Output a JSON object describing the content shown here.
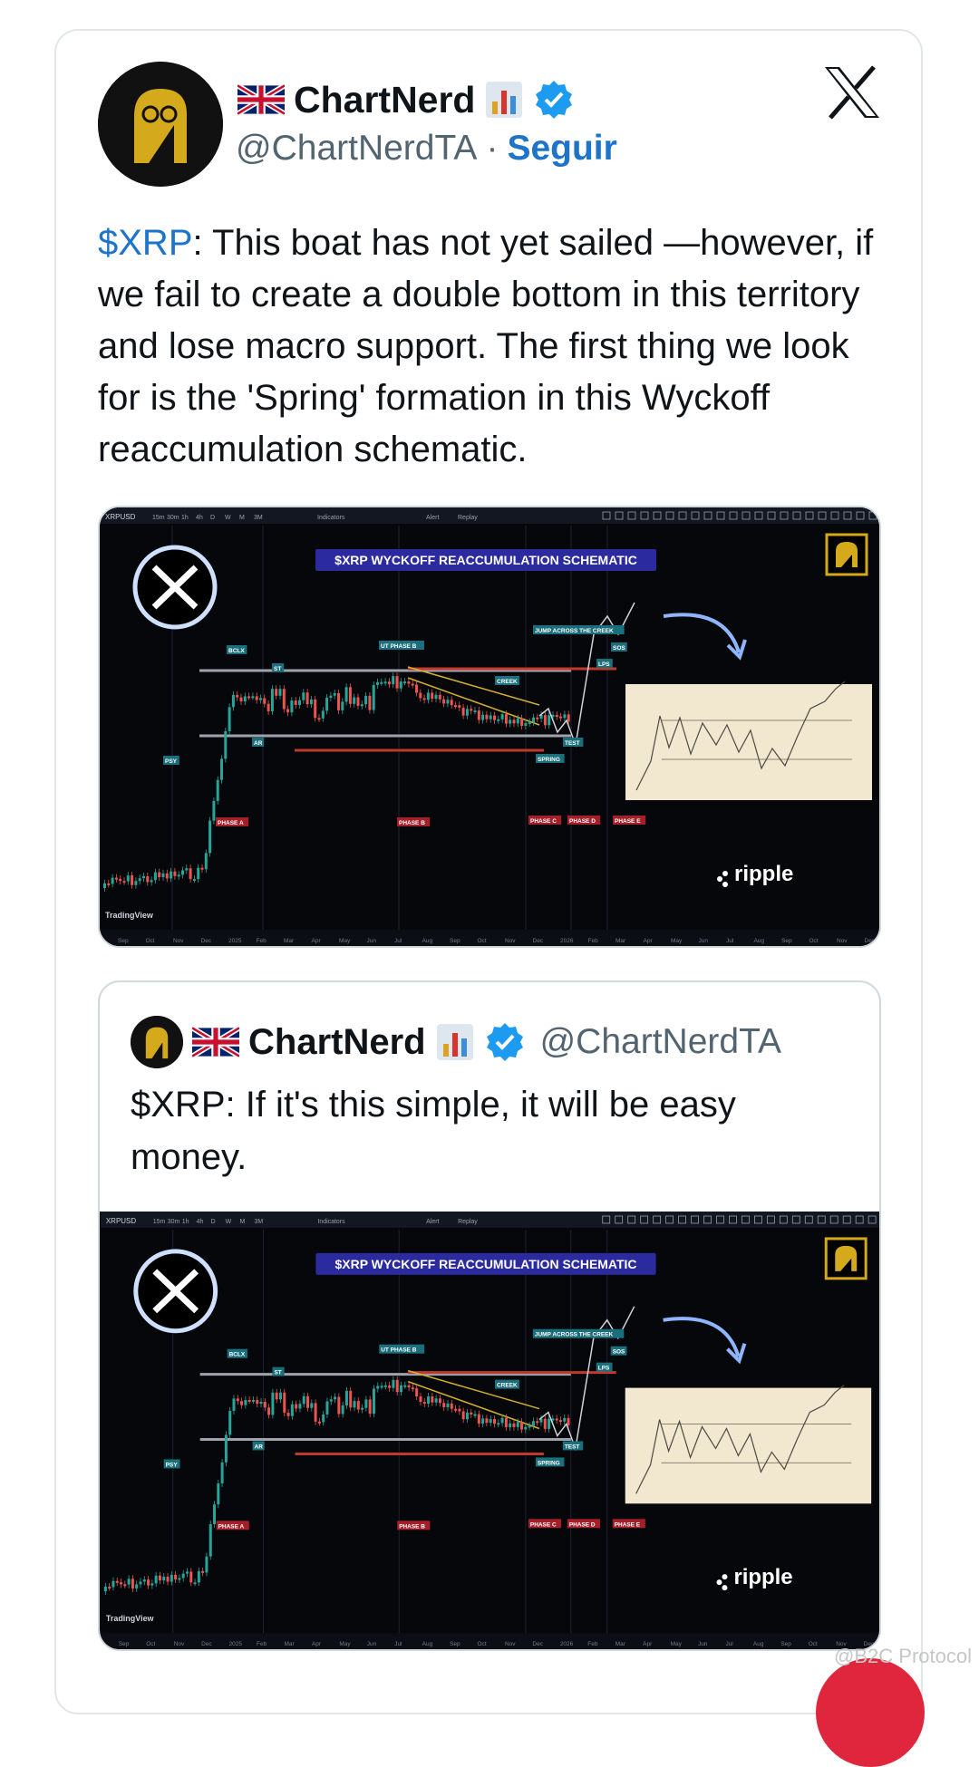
{
  "tweet": {
    "author_name": "ChartNerd",
    "author_handle": "@ChartNerdTA",
    "separator": "·",
    "follow_label": "Seguir",
    "cashtag": "$XRP",
    "text_rest": ": This boat has not yet sailed —however, if we fail to create a double bottom in this territory and lose macro support. The first thing we look for is the 'Spring' formation in this Wyckoff reaccumulation schematic."
  },
  "quote": {
    "author_name": "ChartNerd",
    "author_handle": "@ChartNerdTA",
    "text": "$XRP: If it's this simple, it will be easy money."
  },
  "chart": {
    "symbol": "XRPUSD",
    "timeframes": [
      "15m",
      "30m",
      "1h",
      "4h",
      "D",
      "W",
      "M",
      "3M"
    ],
    "toolbar_indicators": "Indicators",
    "toolbar_alert": "Alert",
    "toolbar_replay": "Replay",
    "title": "$XRP WYCKOFF REACCUMULATION SCHEMATIC",
    "labels": {
      "bclx": "BCLX",
      "st": "ST",
      "ar": "AR",
      "psy": "PSY",
      "ut_phase": "UT PHASE B",
      "creek": "CREEK",
      "jump": "JUMP ACROSS THE CREEK",
      "sos": "SOS",
      "lps": "LPS",
      "test": "TEST",
      "spring": "SPRING",
      "phase_a": "PHASE A",
      "phase_b": "PHASE B",
      "phase_c": "PHASE C",
      "phase_d": "PHASE D",
      "phase_e": "PHASE E"
    },
    "brand": "ripple",
    "tradingview": "TradingView",
    "x_axis": [
      "Sep",
      "Oct",
      "Nov",
      "Dec",
      "2025",
      "Feb",
      "Mar",
      "Apr",
      "May",
      "Jun",
      "Jul",
      "Aug",
      "Sep",
      "Oct",
      "Nov",
      "Dec",
      "2026",
      "Feb",
      "Mar",
      "Apr",
      "May",
      "Jun",
      "Jul",
      "Aug",
      "Sep",
      "Oct",
      "Nov",
      "Dec"
    ]
  },
  "watermark": "@B2C Protocol",
  "colors": {
    "link": "#1d74c9",
    "verified": "#1d9bf0",
    "bull": "#26a69a",
    "bear": "#ef5350"
  }
}
